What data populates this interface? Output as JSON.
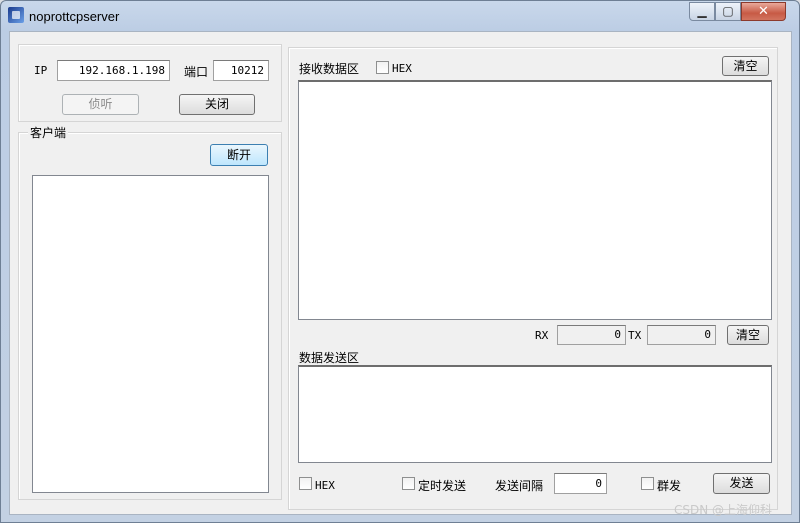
{
  "window": {
    "title": "noprottcpserver"
  },
  "title_controls": {
    "minimize": "▁",
    "maximize": "▢",
    "close": "✕"
  },
  "server": {
    "ip_label": "IP",
    "ip_value": "192.168.1.198",
    "port_label": "端口",
    "port_value": "10212",
    "listen_button": "侦听",
    "close_button": "关闭"
  },
  "client": {
    "group_label": "客户端",
    "disconnect_button": "断开"
  },
  "receive": {
    "group_label": "接收数据区",
    "hex_label": "HEX",
    "clear_button": "清空"
  },
  "stats": {
    "rx_label": "RX",
    "rx_value": "0",
    "tx_label": "TX",
    "tx_value": "0",
    "clear_button": "清空"
  },
  "send": {
    "group_label": "数据发送区",
    "hex_label": "HEX",
    "timed_label": "定时发送",
    "interval_label": "发送间隔",
    "interval_value": "0",
    "broadcast_label": "群发",
    "send_button": "发送"
  },
  "watermark": "CSDN @上海仰科"
}
